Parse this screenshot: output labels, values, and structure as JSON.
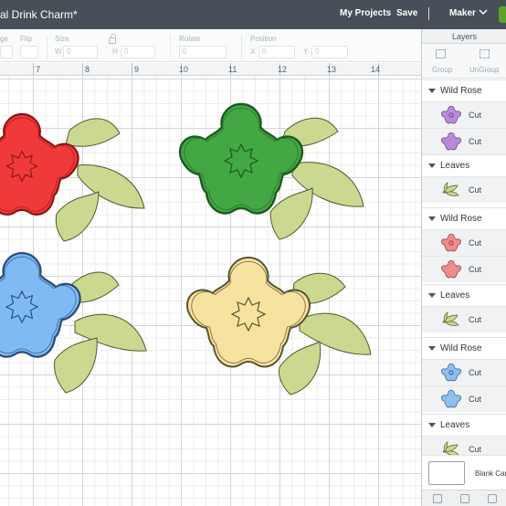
{
  "header": {
    "project_title": "al Drink Charm*",
    "my_projects": "My Projects",
    "save": "Save",
    "machine": "Maker",
    "colors": {
      "bar": "#475058",
      "make_button": "#5ba529"
    }
  },
  "toolbar": {
    "edit_label": "ge",
    "flip_label": "Flip",
    "size_label": "Size",
    "size_w_prefix": "W",
    "size_w_value": "0",
    "size_h_prefix": "H",
    "size_h_value": "0",
    "rotate_label": "Rotate",
    "rotate_value": "0",
    "position_label": "Position",
    "pos_x_prefix": "X",
    "pos_x_value": "0",
    "pos_y_prefix": "Y",
    "pos_y_value": "0"
  },
  "ruler": {
    "numbers": [
      "7",
      "8",
      "9",
      "10",
      "11",
      "12",
      "13",
      "14"
    ]
  },
  "layers_panel": {
    "title": "Layers",
    "group_label": "Group",
    "ungroup_label": "UnGroup",
    "groups": [
      {
        "name": "Wild Rose",
        "rows": [
          {
            "label": "Cut",
            "icon": "flower-icon",
            "color": "#b98bdc"
          },
          {
            "label": "Cut",
            "icon": "flower-icon",
            "color": "#b98bdc"
          }
        ]
      },
      {
        "name": "Leaves",
        "rows": [
          {
            "label": "Cut",
            "icon": "leaves-icon",
            "color": "#c9d98e"
          }
        ]
      },
      {
        "name": "Wild Rose",
        "rows": [
          {
            "label": "Cut",
            "icon": "flower-icon",
            "color": "#ee8b8b"
          },
          {
            "label": "Cut",
            "icon": "flower-icon",
            "color": "#ee8b8b"
          }
        ]
      },
      {
        "name": "Leaves",
        "rows": [
          {
            "label": "Cut",
            "icon": "leaves-icon",
            "color": "#c9d98e"
          }
        ]
      },
      {
        "name": "Wild Rose",
        "rows": [
          {
            "label": "Cut",
            "icon": "flower-icon",
            "color": "#8fbff0"
          },
          {
            "label": "Cut",
            "icon": "flower-icon",
            "color": "#8fbff0"
          }
        ]
      },
      {
        "name": "Leaves",
        "rows": [
          {
            "label": "Cut",
            "icon": "leaves-icon",
            "color": "#c9d98e"
          }
        ]
      }
    ],
    "blank_canvas_label": "Blank Car"
  },
  "canvas": {
    "flowers": [
      {
        "name": "red",
        "fill": "#f03a3a",
        "stroke": "#8a1515"
      },
      {
        "name": "green",
        "fill": "#43a744",
        "stroke": "#1e5a1f"
      },
      {
        "name": "blue",
        "fill": "#7fbaf5",
        "stroke": "#2a4e77"
      },
      {
        "name": "yellow",
        "fill": "#f7e3a0",
        "stroke": "#5b5230"
      }
    ],
    "leaf_color": "#cad98f"
  }
}
